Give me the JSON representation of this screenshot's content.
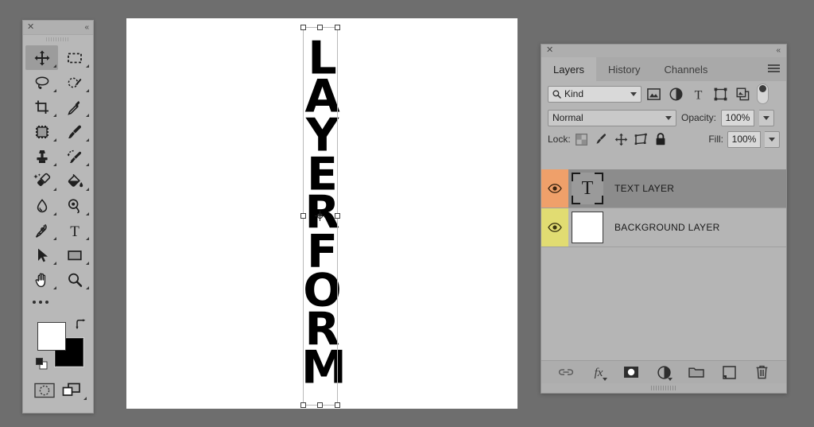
{
  "app": {
    "background_color": "#6e6e6e"
  },
  "canvas": {
    "name": "document-canvas",
    "background_color": "#ffffff",
    "text_letters": [
      "L",
      "A",
      "Y",
      "E",
      "R",
      "F",
      "O",
      "R",
      "M"
    ],
    "text_value": "LAYERFORM",
    "text_color": "#000000",
    "transform_active": true
  },
  "toolbar": {
    "close_label": "✕",
    "collapse_label": "«",
    "tools": [
      {
        "id": "move-tool",
        "label": "Move Tool",
        "active": true,
        "has_more": true
      },
      {
        "id": "marquee-tool",
        "label": "Rectangular Marquee Tool",
        "active": false,
        "has_more": true
      },
      {
        "id": "lasso-tool",
        "label": "Lasso Tool",
        "active": false,
        "has_more": true
      },
      {
        "id": "quick-selection-tool",
        "label": "Quick Selection Tool",
        "active": false,
        "has_more": true
      },
      {
        "id": "crop-tool",
        "label": "Crop Tool",
        "active": false,
        "has_more": true
      },
      {
        "id": "eyedropper-tool",
        "label": "Eyedropper Tool",
        "active": false,
        "has_more": true
      },
      {
        "id": "frame-tool",
        "label": "Frame Tool",
        "active": false,
        "has_more": true
      },
      {
        "id": "brush-tool",
        "label": "Brush Tool",
        "active": false,
        "has_more": true
      },
      {
        "id": "clone-stamp-tool",
        "label": "Clone Stamp Tool",
        "active": false,
        "has_more": true
      },
      {
        "id": "history-brush-tool",
        "label": "History Brush Tool",
        "active": false,
        "has_more": true
      },
      {
        "id": "eraser-tool",
        "label": "Eraser Tool",
        "active": false,
        "has_more": true
      },
      {
        "id": "gradient-tool",
        "label": "Paint Bucket Tool",
        "active": false,
        "has_more": true
      },
      {
        "id": "blur-tool",
        "label": "Blur Tool",
        "active": false,
        "has_more": true
      },
      {
        "id": "dodge-tool",
        "label": "Dodge Tool",
        "active": false,
        "has_more": true
      },
      {
        "id": "pen-tool",
        "label": "Pen Tool",
        "active": false,
        "has_more": true
      },
      {
        "id": "type-tool",
        "label": "Horizontal Type Tool",
        "active": false,
        "has_more": true
      },
      {
        "id": "path-selection-tool",
        "label": "Path Selection Tool",
        "active": false,
        "has_more": true
      },
      {
        "id": "rectangle-tool",
        "label": "Rectangle Tool",
        "active": false,
        "has_more": true
      },
      {
        "id": "hand-tool",
        "label": "Hand Tool",
        "active": false,
        "has_more": true
      },
      {
        "id": "zoom-tool",
        "label": "Zoom Tool",
        "active": false,
        "has_more": true
      }
    ],
    "more_tools_label": "Edit Toolbar",
    "colors": {
      "foreground": "#ffffff",
      "background": "#000000",
      "swap_label": "Switch Foreground and Background Colors",
      "default_label": "Default Foreground and Background Colors"
    },
    "modes": [
      {
        "id": "quick-mask-button",
        "label": "Edit in Quick Mask Mode"
      },
      {
        "id": "screen-mode-button",
        "label": "Change Screen Mode"
      }
    ]
  },
  "layers_panel": {
    "close_label": "✕",
    "collapse_label": "«",
    "menu_label": "Panel Menu",
    "tabs": [
      {
        "id": "tab-layers",
        "label": "Layers",
        "active": true
      },
      {
        "id": "tab-history",
        "label": "History",
        "active": false
      },
      {
        "id": "tab-channels",
        "label": "Channels",
        "active": false
      }
    ],
    "filter": {
      "kind_label": "Kind",
      "icons": [
        {
          "id": "filter-pixel-icon",
          "label": "Filter for pixel layers"
        },
        {
          "id": "filter-adjustment-icon",
          "label": "Filter for adjustment layers"
        },
        {
          "id": "filter-type-icon",
          "label": "Filter for type layers"
        },
        {
          "id": "filter-shape-icon",
          "label": "Filter for shape layers"
        },
        {
          "id": "filter-smart-object-icon",
          "label": "Filter for smart objects"
        }
      ],
      "toggle_label": "Turn layer filtering on/off"
    },
    "blend": {
      "mode": "Normal",
      "opacity_label": "Opacity:",
      "opacity_value": "100%"
    },
    "lock": {
      "label": "Lock:",
      "icons": [
        {
          "id": "lock-transparent-pixels-icon",
          "label": "Lock transparent pixels"
        },
        {
          "id": "lock-image-pixels-icon",
          "label": "Lock image pixels"
        },
        {
          "id": "lock-position-icon",
          "label": "Lock position"
        },
        {
          "id": "lock-artboard-icon",
          "label": "Prevent auto-nesting"
        },
        {
          "id": "lock-all-icon",
          "label": "Lock all"
        }
      ],
      "fill_label": "Fill:",
      "fill_value": "100%"
    },
    "layers": [
      {
        "id": "layer-text",
        "name": "TEXT LAYER",
        "visible": true,
        "selected": true,
        "thumb_type": "text",
        "thumb_glyph": "T",
        "eye_column_color": "#efa06a"
      },
      {
        "id": "layer-background",
        "name": "BACKGROUND LAYER",
        "visible": true,
        "selected": false,
        "thumb_type": "white",
        "thumb_glyph": "",
        "eye_column_color": "#e1dc72"
      }
    ],
    "bottom_buttons": [
      {
        "id": "link-layers-button",
        "label": "Link layers",
        "has_sub": false
      },
      {
        "id": "layer-style-button",
        "label": "fx",
        "has_sub": true
      },
      {
        "id": "add-mask-button",
        "label": "Add layer mask",
        "has_sub": false
      },
      {
        "id": "new-adjustment-layer-button",
        "label": "Create new fill or adjustment layer",
        "has_sub": true
      },
      {
        "id": "new-group-button",
        "label": "Create a new group",
        "has_sub": false
      },
      {
        "id": "new-layer-button",
        "label": "Create a new layer",
        "has_sub": false
      },
      {
        "id": "delete-layer-button",
        "label": "Delete layer",
        "has_sub": false
      }
    ]
  }
}
